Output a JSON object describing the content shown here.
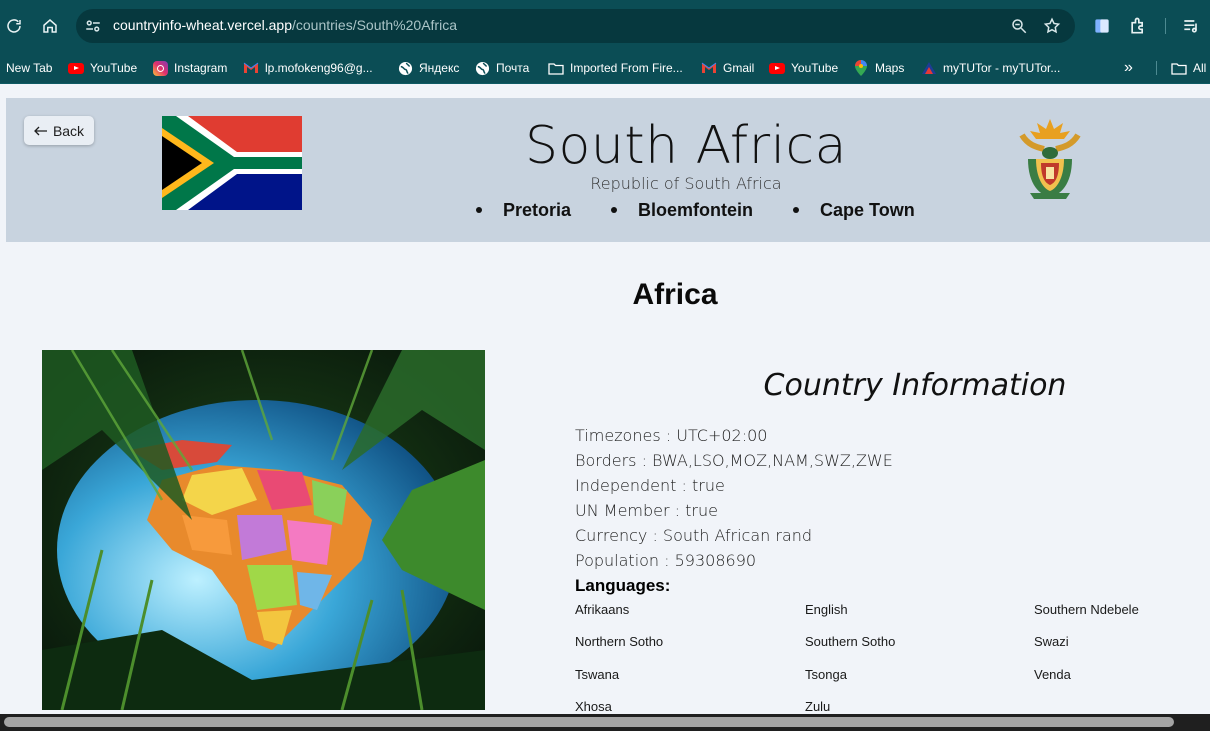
{
  "browser": {
    "url_host": "countryinfo-wheat.vercel.app",
    "url_path": "/countries/South%20Africa",
    "bookmarks": [
      {
        "label": "New Tab",
        "icon": "none"
      },
      {
        "label": "YouTube",
        "icon": "youtube-icon"
      },
      {
        "label": "Instagram",
        "icon": "instagram-icon"
      },
      {
        "label": "lp.mofokeng96@g...",
        "icon": "gmail-icon"
      },
      {
        "label": "Яндекс",
        "icon": "globe-icon"
      },
      {
        "label": "Почта",
        "icon": "globe-icon"
      },
      {
        "label": "Imported From Fire...",
        "icon": "folder-icon"
      },
      {
        "label": "Gmail",
        "icon": "gmail-icon"
      },
      {
        "label": "YouTube",
        "icon": "youtube-icon"
      },
      {
        "label": "Maps",
        "icon": "maps-icon"
      },
      {
        "label": "myTUTor - myTUTor...",
        "icon": "mytutor-icon"
      }
    ],
    "overflow_label": "»",
    "all_bookmarks_label": "All"
  },
  "header": {
    "back_label": "Back",
    "country_name": "South Africa",
    "official_name": "Republic of South Africa",
    "capitals": [
      "Pretoria",
      "Bloemfontein",
      "Cape Town"
    ]
  },
  "region": "Africa",
  "info": {
    "title": "Country Information",
    "facts": [
      "Timezones : UTC+02:00",
      "Borders : BWA,LSO,MOZ,NAM,SWZ,ZWE",
      "Independent : true",
      "UN Member : true",
      "Currency : South African rand",
      "Population : 59308690"
    ],
    "languages_label": "Languages:",
    "languages": [
      "Afrikaans",
      "English",
      "Southern Ndebele",
      "Northern Sotho",
      "Southern Sotho",
      "Swazi",
      "Tswana",
      "Tsonga",
      "Venda",
      "Xhosa",
      "Zulu"
    ]
  },
  "colors": {
    "chrome": "#0b4d55",
    "omnibox": "#06383e",
    "hero_bg": "#c8d3df",
    "page_bg": "#f1f4f9"
  }
}
